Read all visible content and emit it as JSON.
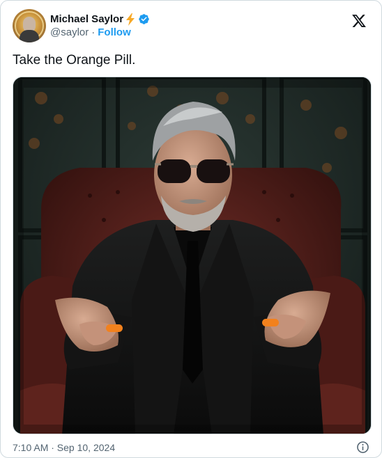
{
  "user": {
    "display_name": "Michael Saylor",
    "handle": "@saylor",
    "separator": "·",
    "follow_label": "Follow"
  },
  "tweet": {
    "text": "Take the Orange Pill.",
    "timestamp": "7:10 AM · Sep 10, 2024"
  },
  "icons": {
    "bolt": "lightning-bolt-icon",
    "verified": "verified-badge-icon",
    "brand": "x-logo-icon",
    "info": "info-icon"
  },
  "colors": {
    "accent": "#1d9bf0",
    "text": "#0f1419",
    "muted": "#536471",
    "bolt": "#f7a928",
    "pill": "#f2811d"
  }
}
